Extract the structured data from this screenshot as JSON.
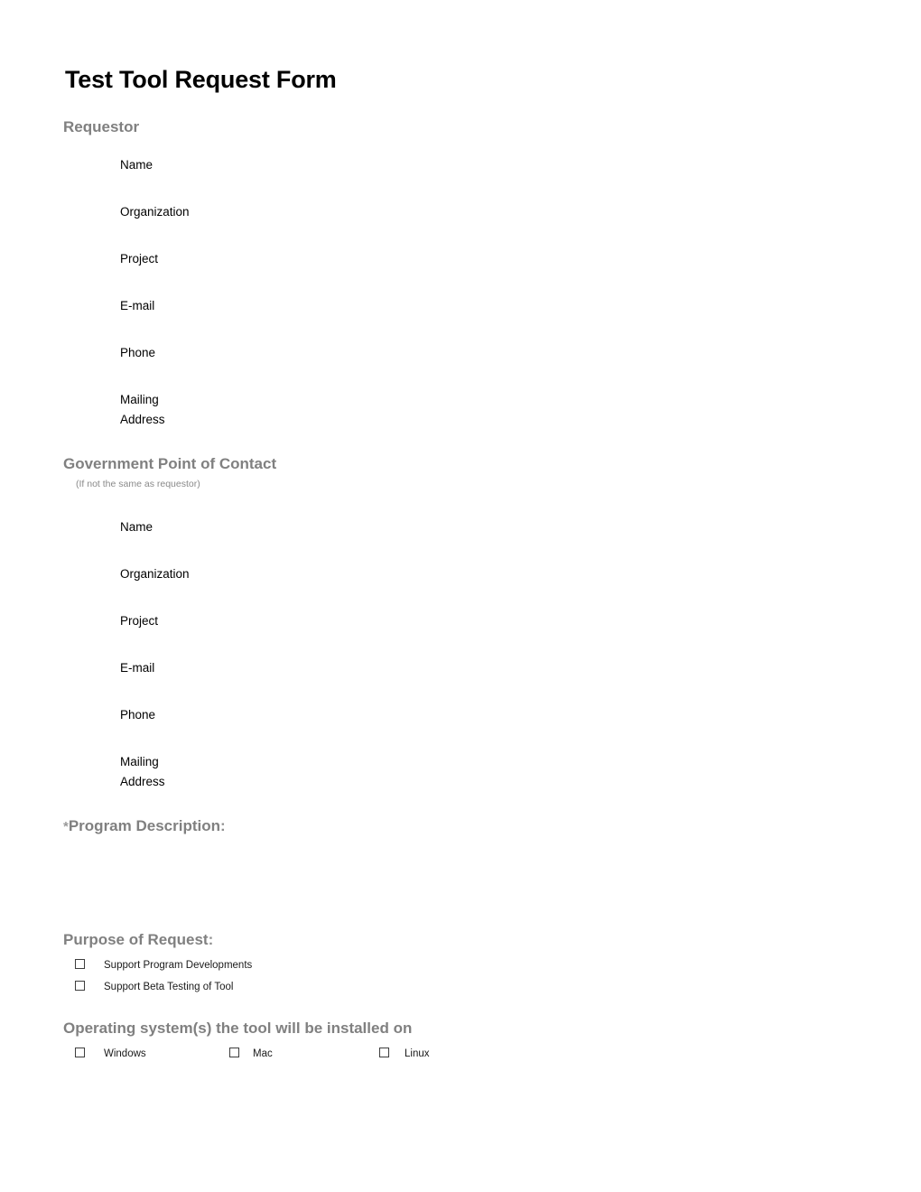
{
  "document": {
    "title": "Test Tool Request Form"
  },
  "sections": {
    "requestor": {
      "heading": "Requestor",
      "fields": [
        {
          "label": "Name"
        },
        {
          "label": "Organization"
        },
        {
          "label": "Project"
        },
        {
          "label": "E-mail"
        },
        {
          "label": "Phone"
        },
        {
          "label": "Mailing\nAddress"
        }
      ]
    },
    "gov_poc": {
      "heading": "Government Point of Contact",
      "subtitle": "(If not the same as requestor)",
      "fields": [
        {
          "label": "Name"
        },
        {
          "label": "Organization"
        },
        {
          "label": "Project"
        },
        {
          "label": "E-mail"
        },
        {
          "label": "Phone"
        },
        {
          "label": "Mailing\nAddress"
        }
      ]
    },
    "program_description": {
      "asterisk": "*",
      "heading": "Program Description",
      "colon": ":"
    },
    "purpose_of_request": {
      "heading": "Purpose of Request",
      "colon": ":",
      "options": [
        {
          "label": "Support Program Developments",
          "checked": false
        },
        {
          "label": "Support Beta Testing of Tool",
          "checked": false
        }
      ]
    },
    "operating_systems": {
      "heading": "Operating system(s) the tool will be installed on",
      "options": [
        {
          "label": "Windows",
          "checked": false
        },
        {
          "label": "Mac",
          "checked": false
        },
        {
          "label": "Linux",
          "checked": false
        }
      ]
    }
  },
  "colors": {
    "heading_gray": "#808080",
    "body_black": "#000000",
    "checkbox_border": "#3d3d3d",
    "page_background": "#ffffff"
  }
}
